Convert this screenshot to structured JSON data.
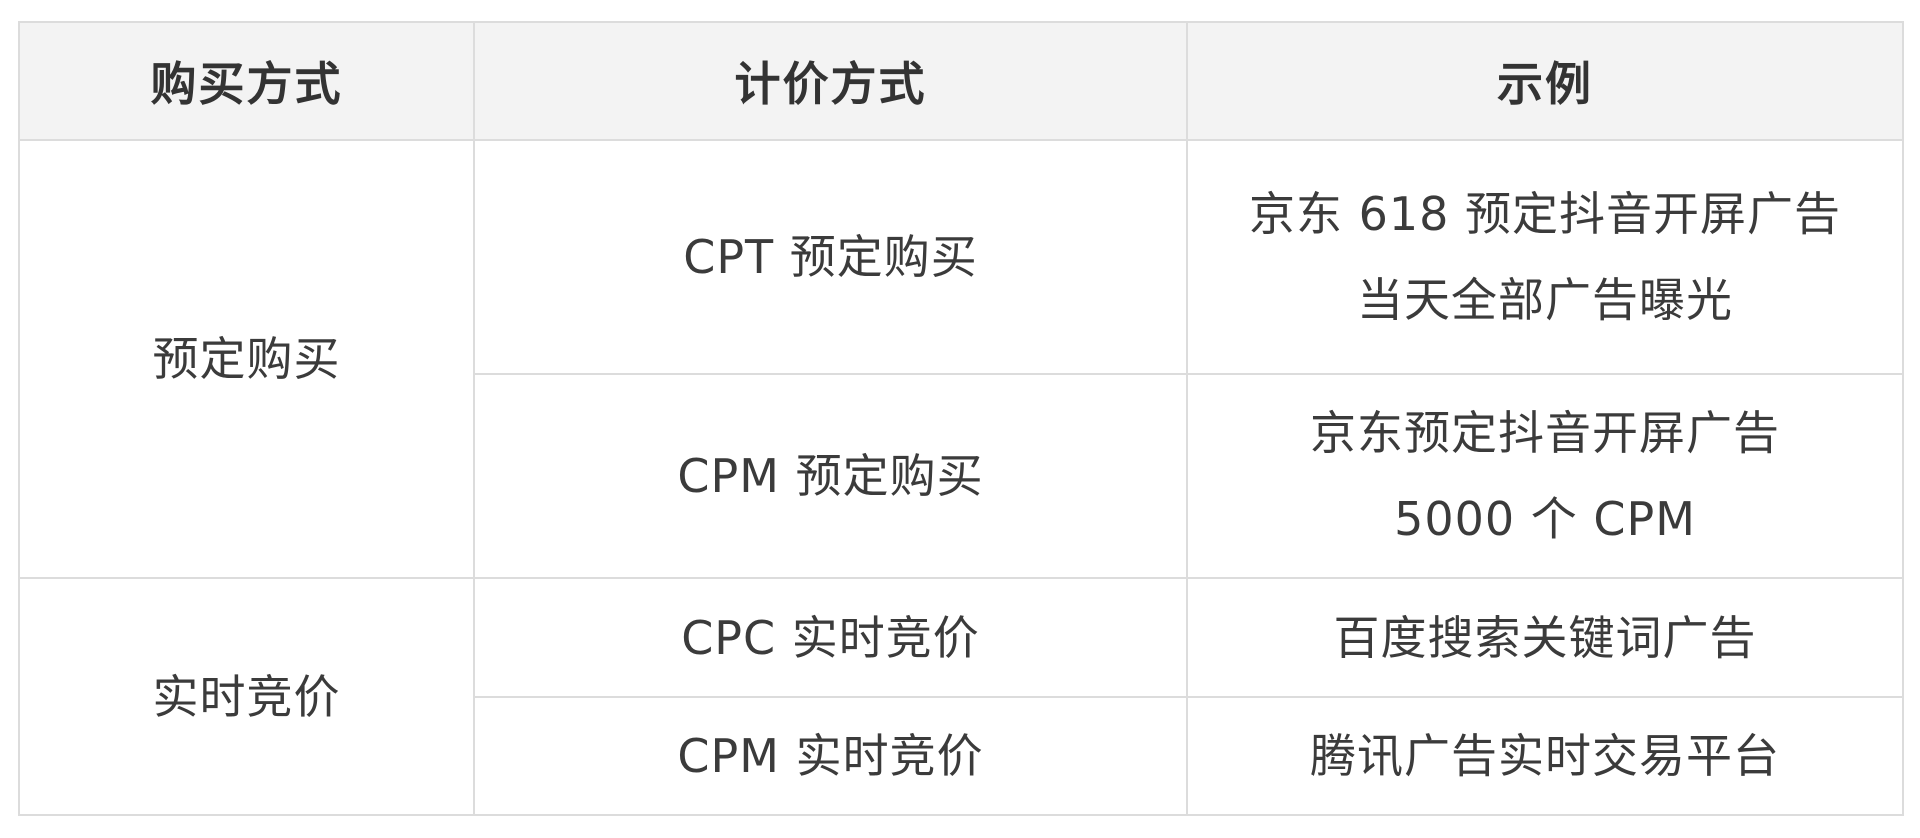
{
  "headers": [
    "购买方式",
    "计价方式",
    "示例"
  ],
  "groups": [
    {
      "purchase": "预定购买",
      "rows": [
        {
          "pricing": "CPT 预定购买",
          "example": [
            "京东 618 预定抖音开屏广告",
            "当天全部广告曝光"
          ]
        },
        {
          "pricing": "CPM 预定购买",
          "example": [
            "京东预定抖音开屏广告",
            "5000 个 CPM"
          ]
        }
      ]
    },
    {
      "purchase": "实时竞价",
      "rows": [
        {
          "pricing": "CPC 实时竞价",
          "example": [
            "百度搜索关键词广告"
          ]
        },
        {
          "pricing": "CPM 实时竞价",
          "example": [
            "腾讯广告实时交易平台"
          ]
        }
      ]
    }
  ]
}
